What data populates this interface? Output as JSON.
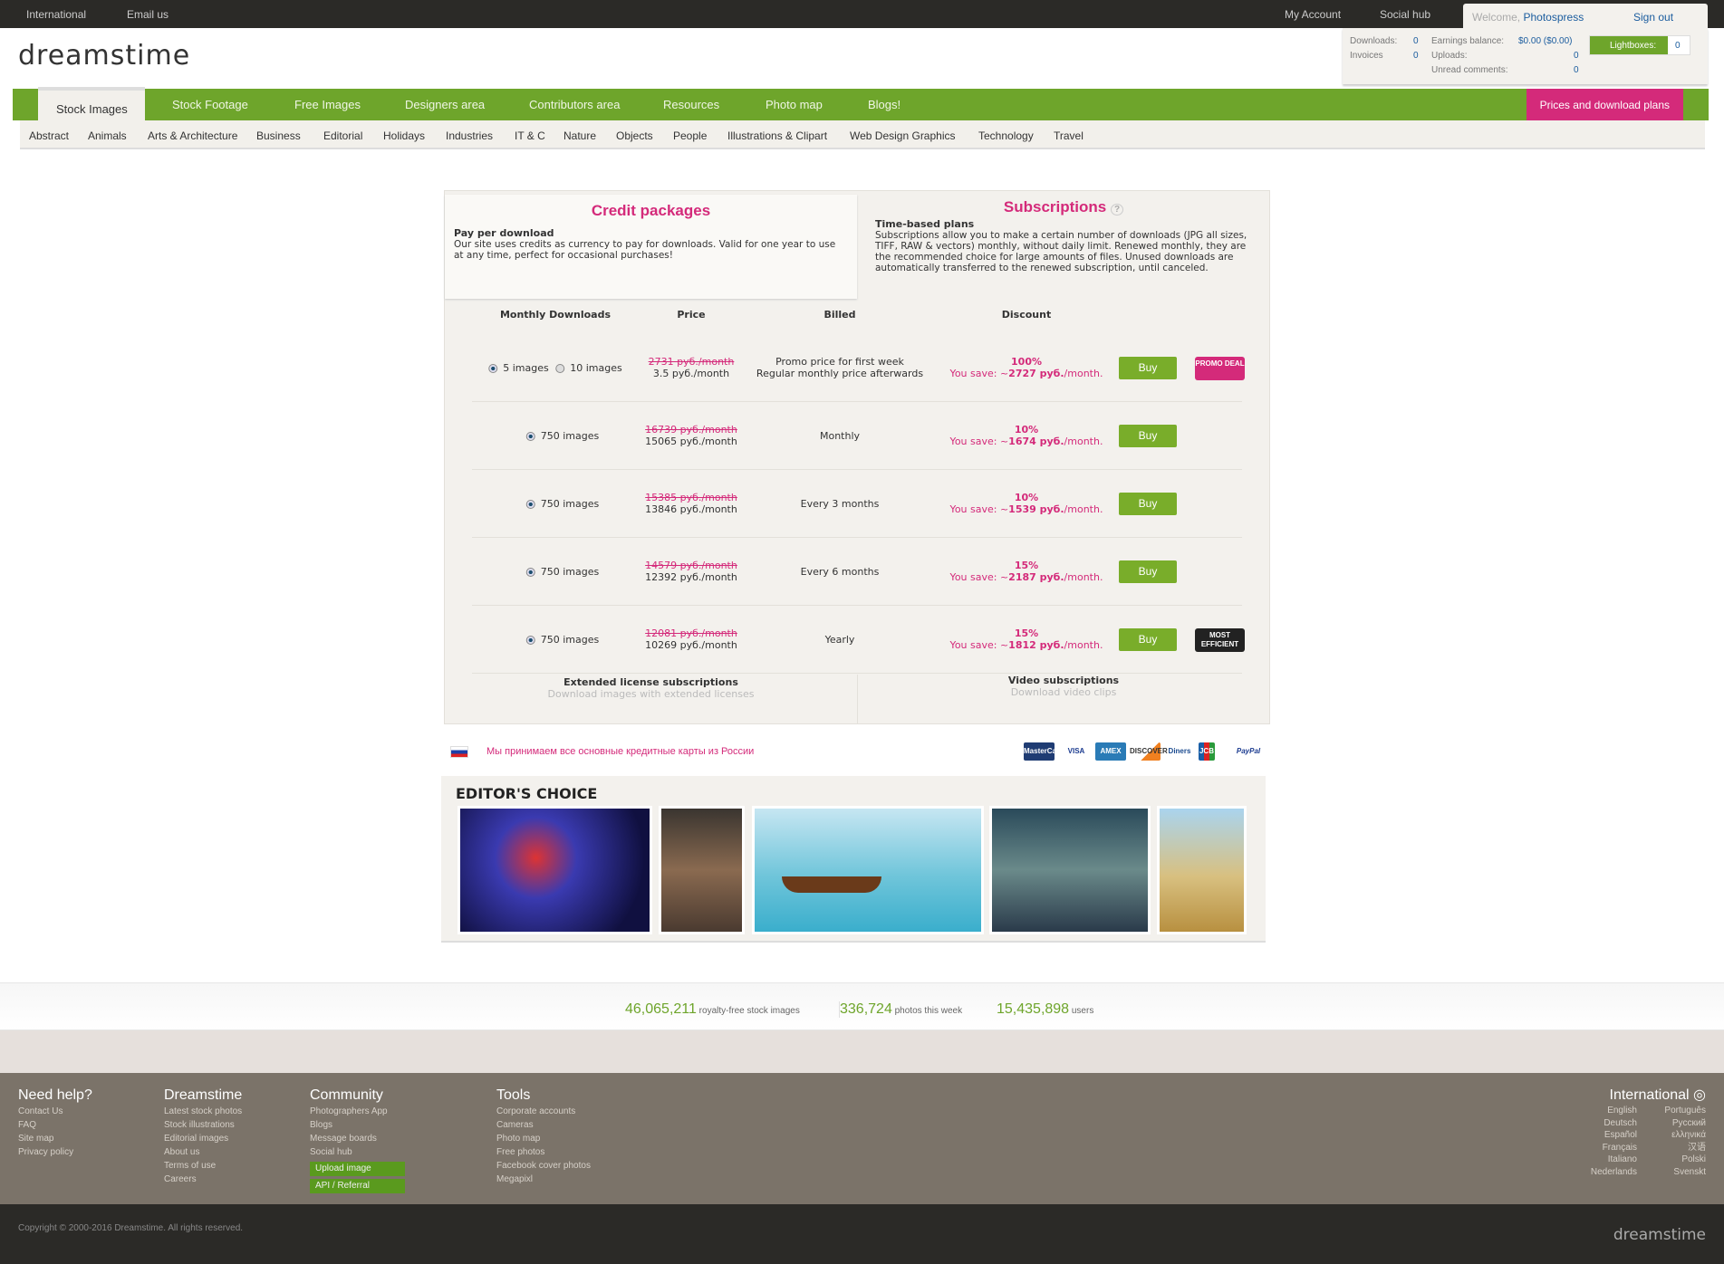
{
  "topbar": {
    "international": "International",
    "email": "Email us",
    "my_account": "My Account",
    "social_hub": "Social hub",
    "welcome": "Welcome,",
    "username": "Photospress",
    "sign_out": "Sign out"
  },
  "account": {
    "downloads_label": "Downloads:",
    "downloads": "0",
    "invoices_label": "Invoices",
    "invoices": "0",
    "earnings_label": "Earnings balance:",
    "earnings": "$0.00 ($0.00)",
    "uploads_label": "Uploads:",
    "uploads": "0",
    "comments_label": "Unread comments:",
    "comments": "0",
    "lightboxes_label": "Lightboxes:",
    "lightboxes": "0"
  },
  "logo": "dreamstime",
  "nav": {
    "items": [
      "Stock Images",
      "Stock Footage",
      "Free Images",
      "Designers area",
      "Contributors area",
      "Resources",
      "Photo map",
      "Blogs!"
    ],
    "prices": "Prices and download plans"
  },
  "subnav": [
    "Abstract",
    "Animals",
    "Arts & Architecture",
    "Business",
    "Editorial",
    "Holidays",
    "Industries",
    "IT & C",
    "Nature",
    "Objects",
    "People",
    "Illustrations & Clipart",
    "Web Design Graphics",
    "Technology",
    "Travel"
  ],
  "credit": {
    "title": "Credit packages",
    "subtitle": "Pay per download",
    "desc": "Our site uses credits as currency to pay for downloads. Valid for one year to use at any time, perfect for occasional purchases!"
  },
  "subs": {
    "title": "Subscriptions",
    "subtitle": "Time-based plans",
    "desc": "Subscriptions allow you to make a certain number of downloads (JPG all sizes, TIFF, RAW & vectors) monthly, without daily limit. Renewed monthly, they are the recommended choice for large amounts of files. Unused downloads are automatically transferred to the renewed subscription, until canceled."
  },
  "table": {
    "headers": [
      "Monthly Downloads",
      "Price",
      "Billed",
      "Discount"
    ],
    "rows": [
      {
        "images": "5 images",
        "images_alt": "10 images",
        "old": "2731 руб./month",
        "price": "3.5 руб./month",
        "billed": "Promo price for first week",
        "billed2": "Regular monthly price afterwards",
        "pct": "100%",
        "save_pre": "You save: ~",
        "save": "2727 руб.",
        "save_post": "/month.",
        "buy": "Buy",
        "badge": "PROMO DEAL"
      },
      {
        "images": "750 images",
        "old": "16739 руб./month",
        "price": "15065 руб./month",
        "billed": "Monthly",
        "pct": "10%",
        "save_pre": "You save: ~",
        "save": "1674 руб.",
        "save_post": "/month.",
        "buy": "Buy"
      },
      {
        "images": "750 images",
        "old": "15385 руб./month",
        "price": "13846 руб./month",
        "billed": "Every 3 months",
        "pct": "10%",
        "save_pre": "You save: ~",
        "save": "1539 руб.",
        "save_post": "/month.",
        "buy": "Buy"
      },
      {
        "images": "750 images",
        "old": "14579 руб./month",
        "price": "12392 руб./month",
        "billed": "Every 6 months",
        "pct": "15%",
        "save_pre": "You save: ~",
        "save": "2187 руб.",
        "save_post": "/month.",
        "buy": "Buy"
      },
      {
        "images": "750 images",
        "old": "12081 руб./month",
        "price": "10269 руб./month",
        "billed": "Yearly",
        "pct": "15%",
        "save_pre": "You save: ~",
        "save": "1812 руб.",
        "save_post": "/month.",
        "buy": "Buy",
        "badge": "MOST EFFICIENT"
      }
    ]
  },
  "extended": {
    "title": "Extended license subscriptions",
    "sub": "Download images with extended licenses"
  },
  "video": {
    "title": "Video subscriptions",
    "sub": "Download video clips"
  },
  "payment": {
    "text": "Мы принимаем все основные кредитные карты из России",
    "cards": [
      "MasterCard",
      "VISA",
      "AMEX",
      "DISCOVER",
      "Diners",
      "JCB",
      "PayPal"
    ]
  },
  "editors": {
    "title": "EDITOR'S CHOICE"
  },
  "stats": [
    {
      "n": "46,065,211",
      "t": "royalty-free stock images"
    },
    {
      "n": "336,724",
      "t": "photos this week"
    },
    {
      "n": "15,435,898",
      "t": "users"
    }
  ],
  "footer": {
    "cols": [
      {
        "title": "Need help?",
        "links": [
          "Contact Us",
          "FAQ",
          "Site map",
          "Privacy policy"
        ]
      },
      {
        "title": "Dreamstime",
        "links": [
          "Latest stock photos",
          "Stock illustrations",
          "Editorial images",
          "About us",
          "Terms of use",
          "Careers"
        ]
      },
      {
        "title": "Community",
        "links": [
          "Photographers App",
          "Blogs",
          "Message boards",
          "Social hub"
        ],
        "buttons": [
          "Upload image",
          "API / Referral"
        ]
      },
      {
        "title": "Tools",
        "links": [
          "Corporate accounts",
          "Cameras",
          "Photo map",
          "Free photos",
          "Facebook cover photos",
          "Megapixl"
        ]
      }
    ],
    "intl_title": "International",
    "languages": [
      "English",
      "Português",
      "Deutsch",
      "Русский",
      "Español",
      "ελληνικά",
      "Français",
      "汉语",
      "Italiano",
      "Polski",
      "Nederlands",
      "Svenskt"
    ]
  },
  "copyright": "Copyright © 2000-2016 Dreamstime. All rights reserved."
}
